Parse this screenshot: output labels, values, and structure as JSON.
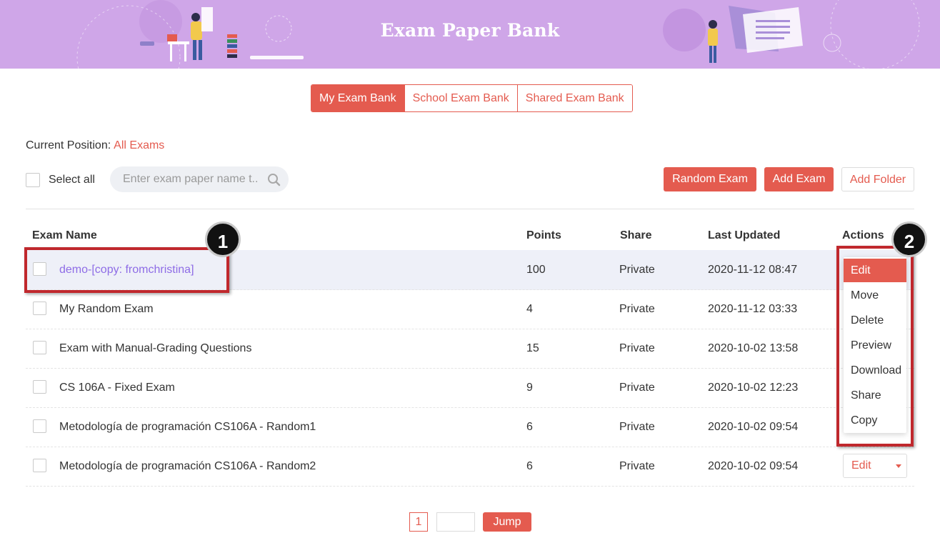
{
  "banner": {
    "title": "Exam Paper Bank"
  },
  "tabs": [
    {
      "label": "My Exam Bank",
      "active": true
    },
    {
      "label": "School Exam Bank",
      "active": false
    },
    {
      "label": "Shared Exam Bank",
      "active": false
    }
  ],
  "position": {
    "label": "Current Position:",
    "link": "All Exams"
  },
  "toolbar": {
    "select_all_label": "Select all",
    "search_placeholder": "Enter exam paper name t...",
    "random_exam": "Random Exam",
    "add_exam": "Add Exam",
    "add_folder": "Add Folder"
  },
  "table": {
    "headers": {
      "name": "Exam Name",
      "points": "Points",
      "share": "Share",
      "updated": "Last Updated",
      "actions": "Actions"
    },
    "rows": [
      {
        "name": "demo-[copy: fromchristina]",
        "points": "100",
        "share": "Private",
        "updated": "2020-11-12 08:47"
      },
      {
        "name": "My Random Exam",
        "points": "4",
        "share": "Private",
        "updated": "2020-11-12 03:33"
      },
      {
        "name": "Exam with Manual-Grading Questions",
        "points": "15",
        "share": "Private",
        "updated": "2020-10-02 13:58"
      },
      {
        "name": "CS 106A - Fixed Exam",
        "points": "9",
        "share": "Private",
        "updated": "2020-10-02 12:23"
      },
      {
        "name": "Metodología de programación CS106A - Random1",
        "points": "6",
        "share": "Private",
        "updated": "2020-10-02 09:54"
      },
      {
        "name": "Metodología de programación CS106A - Random2",
        "points": "6",
        "share": "Private",
        "updated": "2020-10-02 09:54"
      }
    ]
  },
  "dropdown": {
    "items": [
      "Edit",
      "Move",
      "Delete",
      "Preview",
      "Download",
      "Share",
      "Copy"
    ]
  },
  "action_select": {
    "label": "Edit"
  },
  "annotations": {
    "badge1": "1",
    "badge2": "2"
  },
  "pagination": {
    "current_page": "1",
    "jump_label": "Jump"
  },
  "colors": {
    "accent": "#e45b4f",
    "banner": "#cfa6e8",
    "link": "#8e6ce6",
    "annotation": "#c0282d"
  }
}
